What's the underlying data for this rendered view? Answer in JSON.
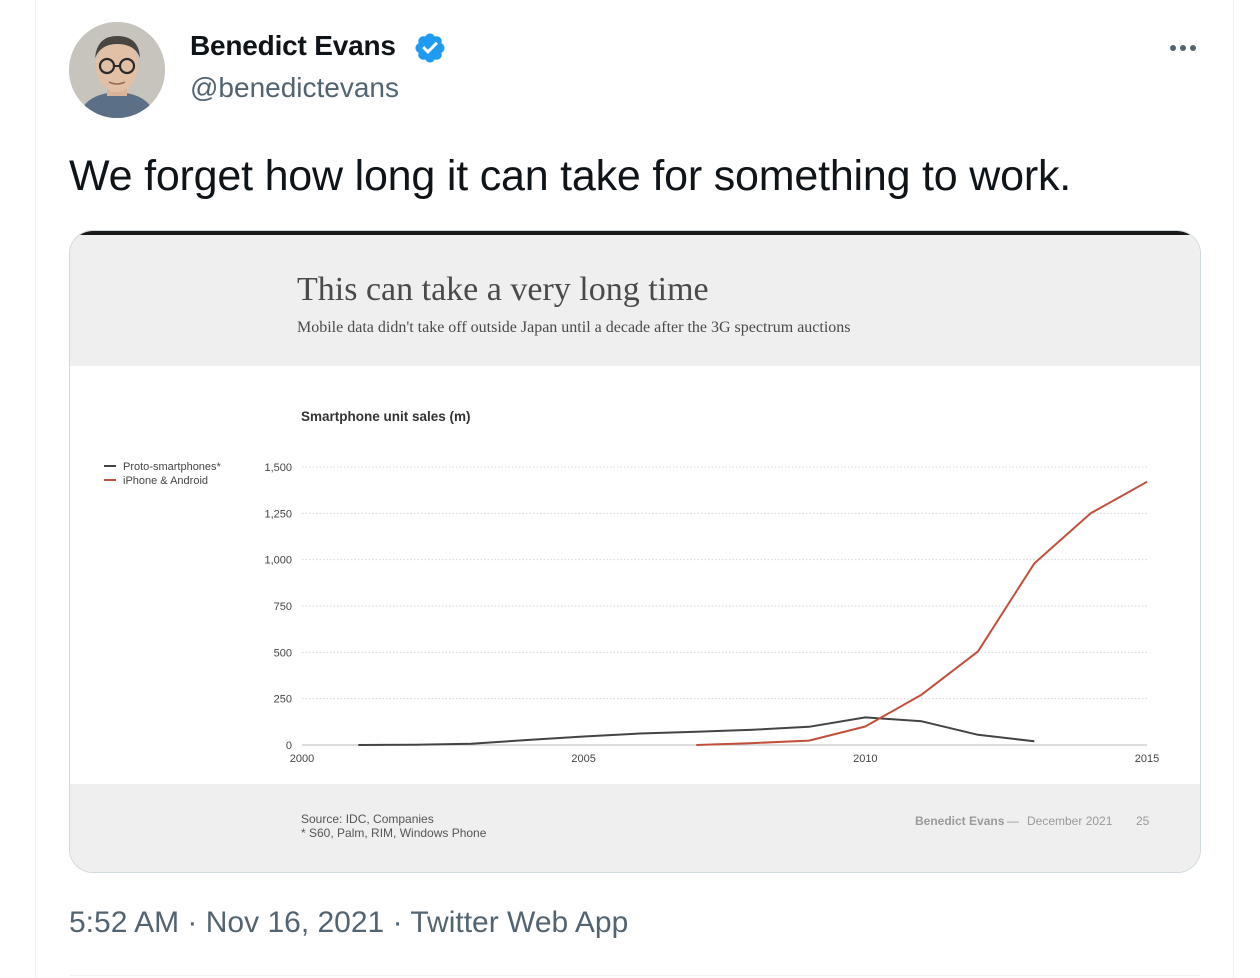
{
  "tweet": {
    "author_name": "Benedict Evans",
    "author_handle": "@benedictevans",
    "text": "We forget how long it can take for something to work.",
    "time": "5:52 AM",
    "separator": "·",
    "date": "Nov 16, 2021",
    "source": "Twitter Web App"
  },
  "slide": {
    "title": "This can take a very long time",
    "subtitle": "Mobile data didn't take off outside Japan until a decade after the 3G spectrum auctions",
    "footer": {
      "source": "Source: IDC, Companies",
      "footnote": "* S60, Palm, RIM, Windows Phone",
      "author": "Benedict Evans",
      "dash": "—",
      "date": "December 2021",
      "page": "25"
    }
  },
  "chart_data": {
    "type": "line",
    "title": "Smartphone unit sales (m)",
    "xlabel": "",
    "ylabel": "",
    "xlim": [
      2000,
      2015
    ],
    "ylim": [
      0,
      1500
    ],
    "x_ticks": [
      2000,
      2005,
      2010,
      2015
    ],
    "y_ticks": [
      0,
      250,
      500,
      750,
      1000,
      1250,
      1500
    ],
    "y_tick_labels": [
      "0",
      "250",
      "500",
      "750",
      "1,000",
      "1,250",
      "1,500"
    ],
    "grid": true,
    "legend_position": "left",
    "series": [
      {
        "name": "Proto-smartphones*",
        "color": "#444444",
        "x": [
          2001,
          2002,
          2003,
          2004,
          2005,
          2006,
          2007,
          2008,
          2009,
          2010,
          2011,
          2012,
          2013
        ],
        "y": [
          0,
          1,
          7,
          27,
          46,
          62,
          72,
          82,
          98,
          149,
          128,
          55,
          20
        ]
      },
      {
        "name": "iPhone & Android",
        "color": "#c0503c",
        "x": [
          2007,
          2008,
          2009,
          2010,
          2011,
          2012,
          2013,
          2014,
          2015
        ],
        "y": [
          0,
          10,
          24,
          100,
          272,
          505,
          980,
          1250,
          1420
        ]
      }
    ]
  },
  "colors": {
    "verified": "#1d9bf0",
    "text_primary": "#0f1419",
    "text_secondary": "#536471"
  }
}
